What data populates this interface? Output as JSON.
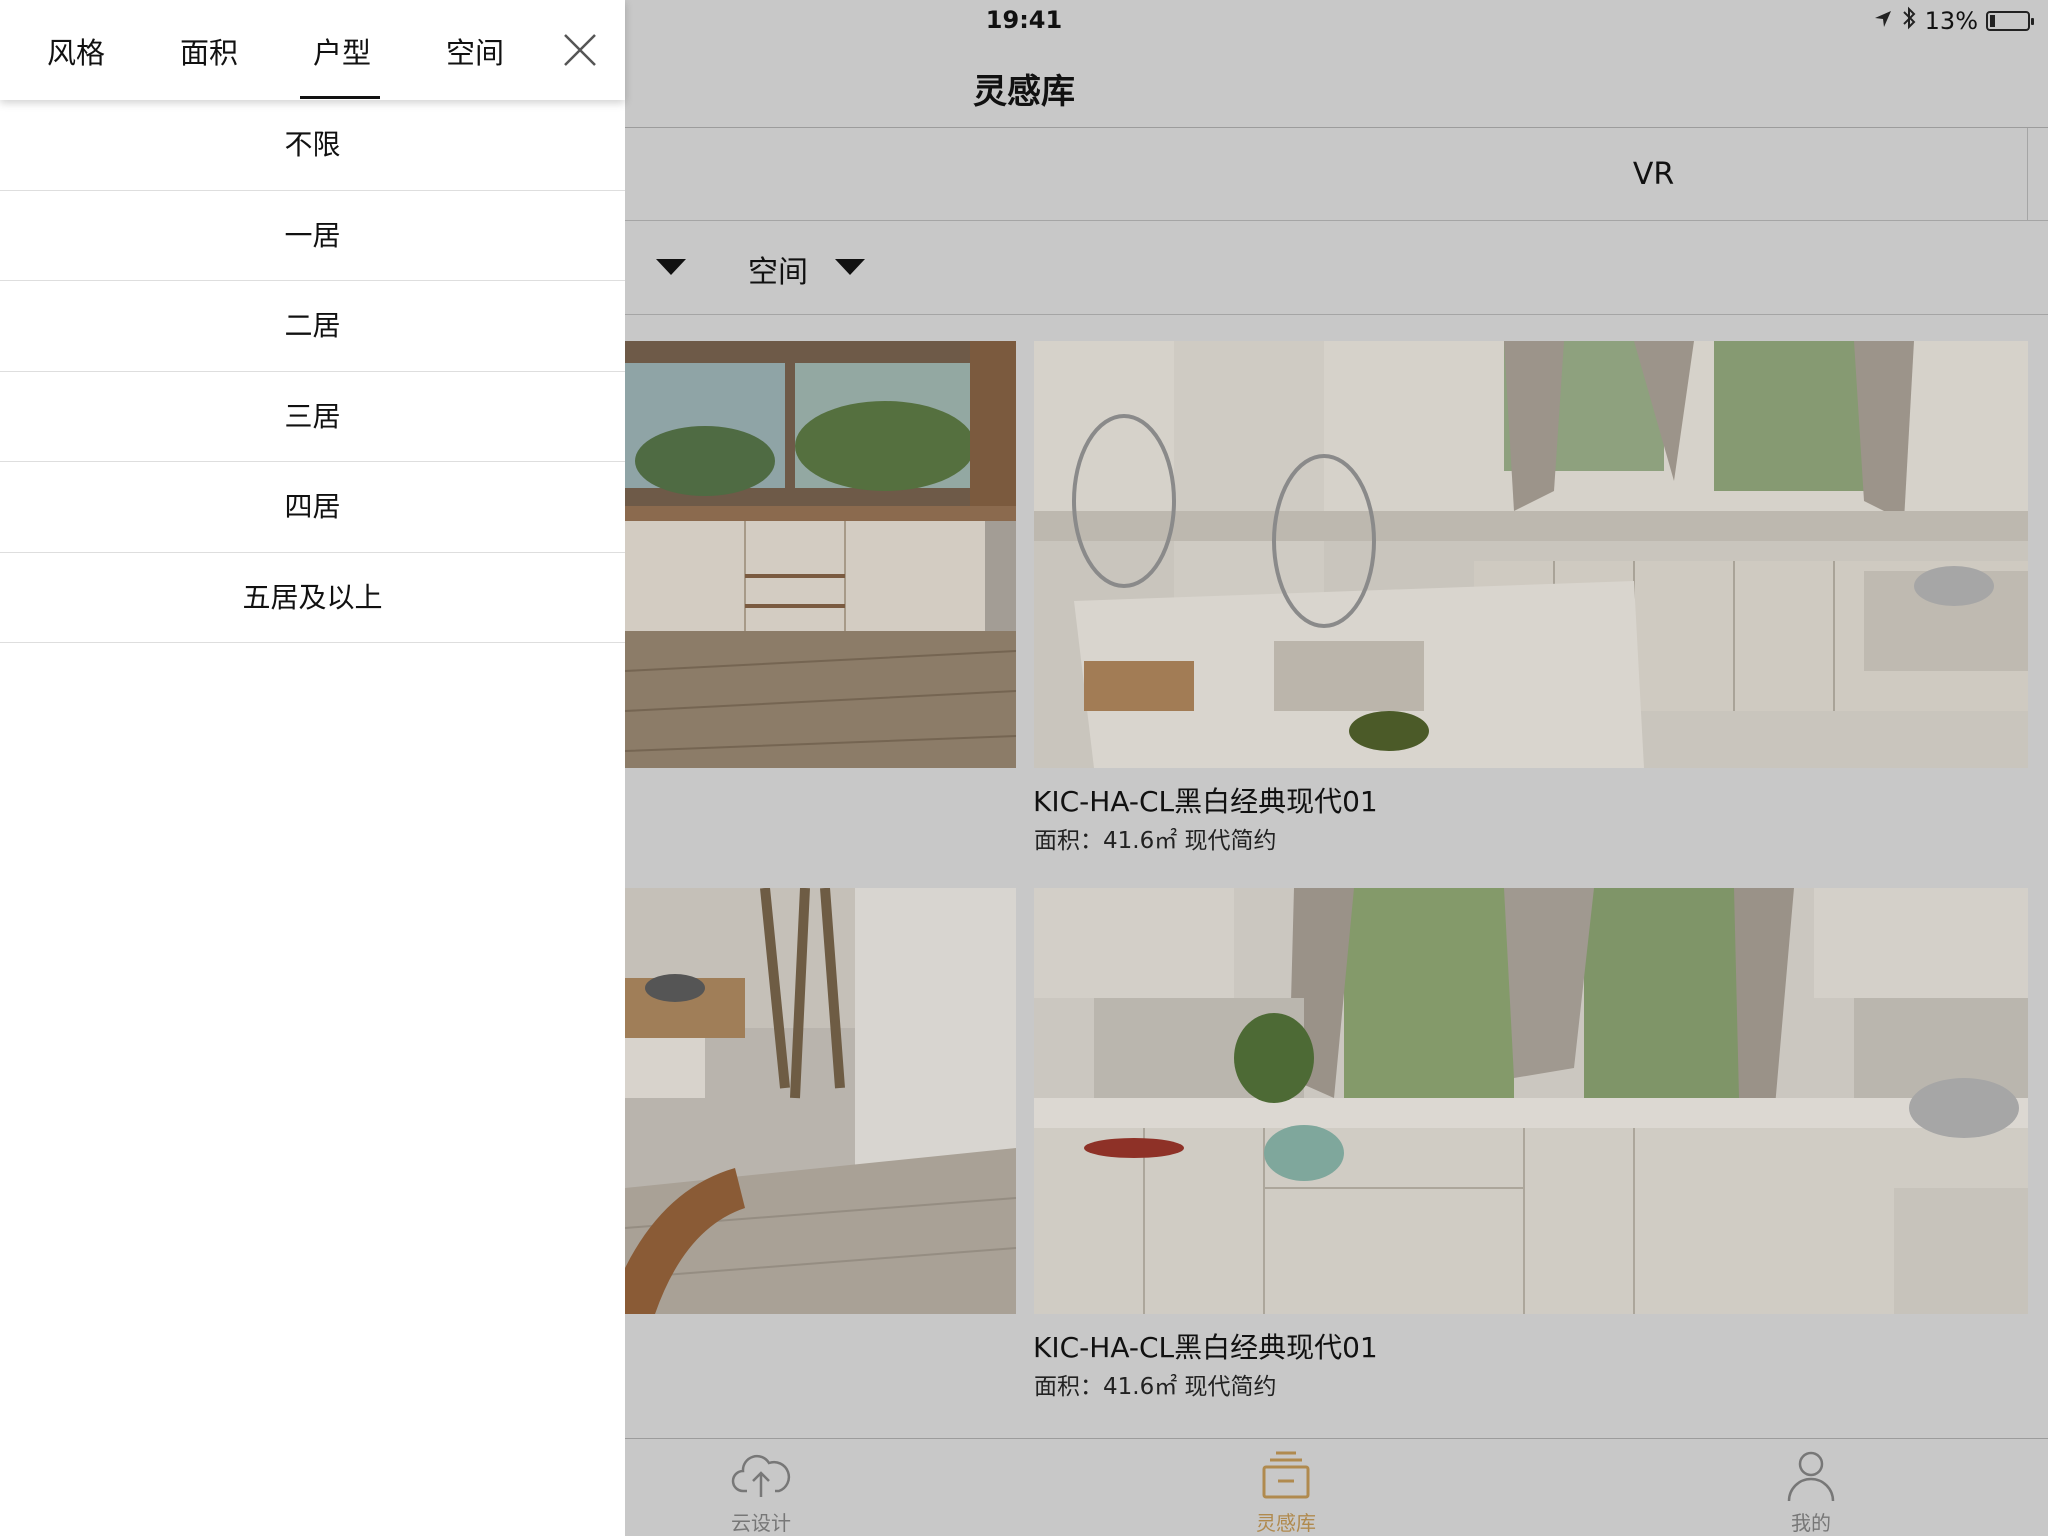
{
  "status_bar": {
    "time": "19:41",
    "battery": "13%",
    "battery_level": 0.13
  },
  "header": {
    "title": "灵感库"
  },
  "segments": {
    "vr_label": "VR"
  },
  "filters": {
    "space_label": "空间"
  },
  "cards": [
    {
      "title": "",
      "subtitle": ""
    },
    {
      "title": "KIC-HA-CL黑白经典现代01",
      "subtitle": "面积：41.6㎡ 现代简约"
    },
    {
      "title": "",
      "subtitle": ""
    },
    {
      "title": "KIC-HA-CL黑白经典现代01",
      "subtitle": "面积：41.6㎡ 现代简约"
    }
  ],
  "tabbar": {
    "items": [
      {
        "label": "云设计",
        "icon": "cloud-upload-icon"
      },
      {
        "label": "灵感库",
        "icon": "inbox-icon",
        "active": true
      },
      {
        "label": "我的",
        "icon": "person-icon"
      }
    ],
    "active_color": "#b08a4e",
    "inactive_color": "#777777"
  },
  "drawer": {
    "tabs": [
      "风格",
      "面积",
      "户型",
      "空间"
    ],
    "active_tab": "户型",
    "options": [
      "不限",
      "一居",
      "二居",
      "三居",
      "四居",
      "五居及以上"
    ]
  }
}
